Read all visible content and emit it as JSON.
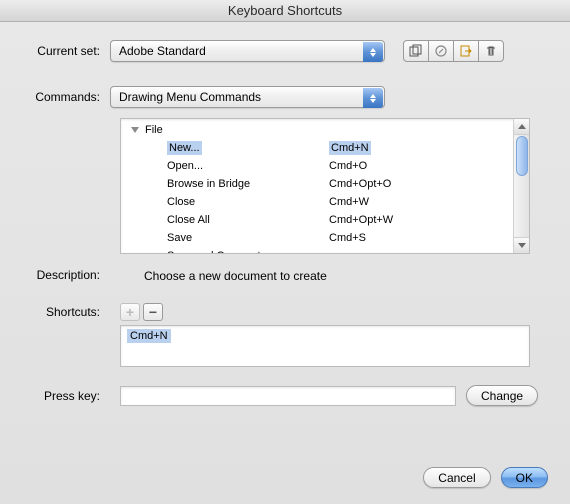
{
  "title": "Keyboard Shortcuts",
  "labels": {
    "current_set": "Current set:",
    "commands": "Commands:",
    "description": "Description:",
    "shortcuts": "Shortcuts:",
    "press_key": "Press key:"
  },
  "current_set": {
    "value": "Adobe Standard"
  },
  "commands_select": {
    "value": "Drawing Menu Commands"
  },
  "tree": {
    "group": "File",
    "items": [
      {
        "name": "New...",
        "shortcut": "Cmd+N",
        "selected": true
      },
      {
        "name": "Open...",
        "shortcut": "Cmd+O"
      },
      {
        "name": "Browse in Bridge",
        "shortcut": "Cmd+Opt+O"
      },
      {
        "name": "Close",
        "shortcut": "Cmd+W"
      },
      {
        "name": "Close All",
        "shortcut": "Cmd+Opt+W"
      },
      {
        "name": "Save",
        "shortcut": "Cmd+S"
      },
      {
        "name": "Save and Compact",
        "shortcut": ""
      }
    ]
  },
  "description_text": "Choose a new document to create",
  "shortcuts_list": [
    "Cmd+N"
  ],
  "presskey_value": "",
  "buttons": {
    "change": "Change",
    "cancel": "Cancel",
    "ok": "OK",
    "plus": "+",
    "minus": "−"
  }
}
